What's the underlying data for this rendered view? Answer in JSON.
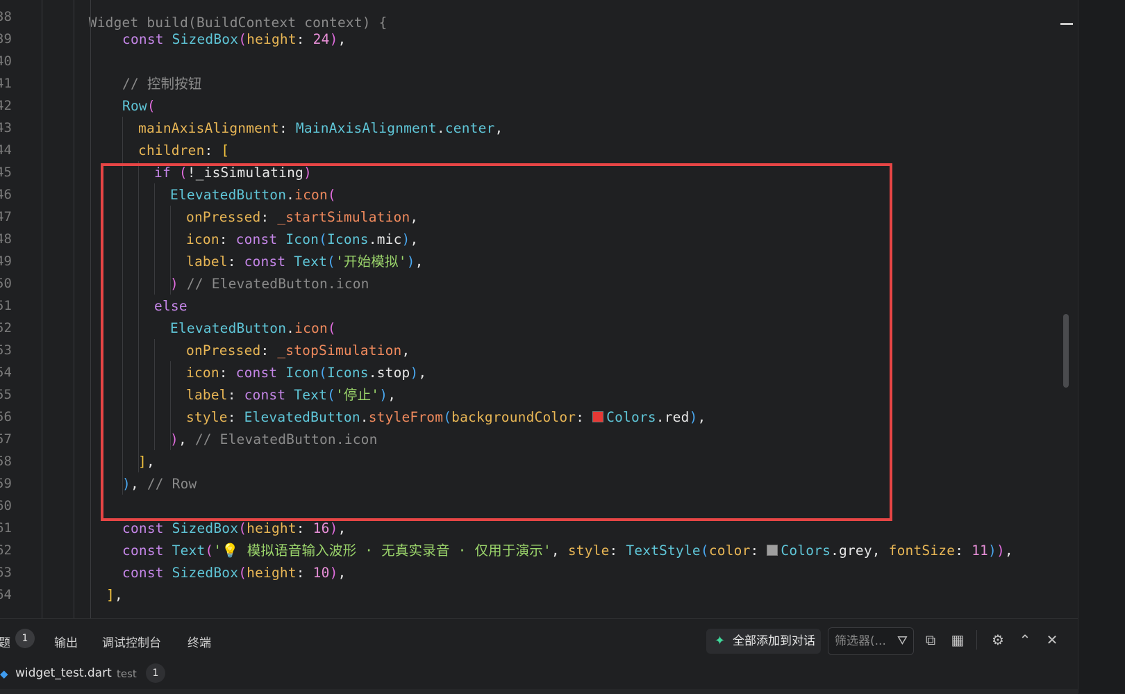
{
  "editor": {
    "partial_top": "Widget build(BuildContext context) {",
    "line_numbers": [
      "38",
      "39",
      "40",
      "41",
      "42",
      "43",
      "44",
      "45",
      "46",
      "47",
      "48",
      "49",
      "50",
      "51",
      "52",
      "53",
      "54",
      "55",
      "56",
      "57",
      "58",
      "59",
      "60",
      "61",
      "62",
      "63",
      "64"
    ],
    "lines": {
      "l39": {
        "kw": "const",
        "ty": "SizedBox",
        "prop": "height",
        "num": "24"
      },
      "l41": {
        "comment": "// 控制按钮"
      },
      "l42": {
        "ty": "Row"
      },
      "l43": {
        "prop": "mainAxisAlignment",
        "ty": "MainAxisAlignment",
        "member": "center"
      },
      "l44": {
        "prop": "children"
      },
      "l45": {
        "kw": "if",
        "expr": "!_isSimulating"
      },
      "l46": {
        "ty": "ElevatedButton",
        "member": "icon"
      },
      "l47": {
        "prop": "onPressed",
        "fn": "_startSimulation"
      },
      "l48": {
        "prop": "icon",
        "kw": "const",
        "ty": "Icon",
        "ty2": "Icons",
        "member": "mic"
      },
      "l49": {
        "prop": "label",
        "kw": "const",
        "ty": "Text",
        "str": "'开始模拟'"
      },
      "l50": {
        "comment": "// ElevatedButton.icon"
      },
      "l51": {
        "kw": "else"
      },
      "l52": {
        "ty": "ElevatedButton",
        "member": "icon"
      },
      "l53": {
        "prop": "onPressed",
        "fn": "_stopSimulation"
      },
      "l54": {
        "prop": "icon",
        "kw": "const",
        "ty": "Icon",
        "ty2": "Icons",
        "member": "stop"
      },
      "l55": {
        "prop": "label",
        "kw": "const",
        "ty": "Text",
        "str": "'停止'"
      },
      "l56": {
        "prop": "style",
        "ty": "ElevatedButton",
        "member": "styleFrom",
        "prop2": "backgroundColor",
        "ty2": "Colors",
        "member2": "red",
        "swatch": "#e53935"
      },
      "l57": {
        "comment": "// ElevatedButton.icon"
      },
      "l59": {
        "comment": "// Row"
      },
      "l61": {
        "kw": "const",
        "ty": "SizedBox",
        "prop": "height",
        "num": "16"
      },
      "l62": {
        "kw": "const",
        "ty": "Text",
        "str": "'💡 模拟语音输入波形 · 无真实录音 · 仅用于演示'",
        "prop": "style",
        "ty2": "TextStyle",
        "prop2": "color",
        "ty3": "Colors",
        "member": "grey",
        "prop3": "fontSize",
        "num": "11",
        "swatch": "#9e9e9e"
      },
      "l63": {
        "kw": "const",
        "ty": "SizedBox",
        "prop": "height",
        "num": "10"
      }
    }
  },
  "panel": {
    "tabs": {
      "problems": "题",
      "problems_count": "1",
      "output": "输出",
      "debug_console": "调试控制台",
      "terminal": "终端"
    },
    "add_all": "全部添加到对话",
    "filter_placeholder": "筛选器(...",
    "file": {
      "name": "widget_test.dart",
      "dir": "test",
      "count": "1"
    }
  },
  "colors": {
    "highlight_border": "#e64545",
    "accent_spark": "#3fd89a",
    "file_icon": "#3f9cf0"
  }
}
